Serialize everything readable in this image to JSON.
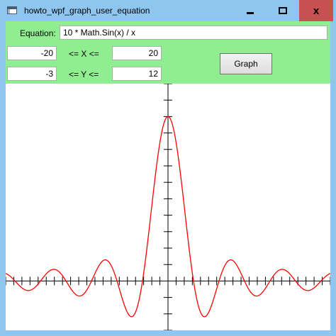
{
  "window": {
    "title": "howto_wpf_graph_user_equation",
    "close_glyph": "x",
    "icons": {
      "app": "window-app-icon",
      "minimize": "minimize-icon",
      "maximize": "maximize-icon",
      "close": "close-icon"
    }
  },
  "form": {
    "equation_label": "Equation:",
    "equation_value": "10 * Math.Sin(x) / x",
    "xmin": "-20",
    "x_range_label": "<= X <=",
    "xmax": "20",
    "ymin": "-3",
    "y_range_label": "<= Y <=",
    "ymax": "12",
    "graph_button": "Graph"
  },
  "colors": {
    "panel": "#90ee90",
    "curve": "#ff0000",
    "axes": "#000000"
  },
  "chart_data": {
    "type": "line",
    "function": "10 * Math.Sin(x) / x",
    "xlim": [
      -20,
      20
    ],
    "ylim": [
      -3,
      12
    ],
    "x_tick_step": 1,
    "y_tick_step": 1,
    "grid": false,
    "series": [
      {
        "color": "#ff0000"
      }
    ]
  }
}
